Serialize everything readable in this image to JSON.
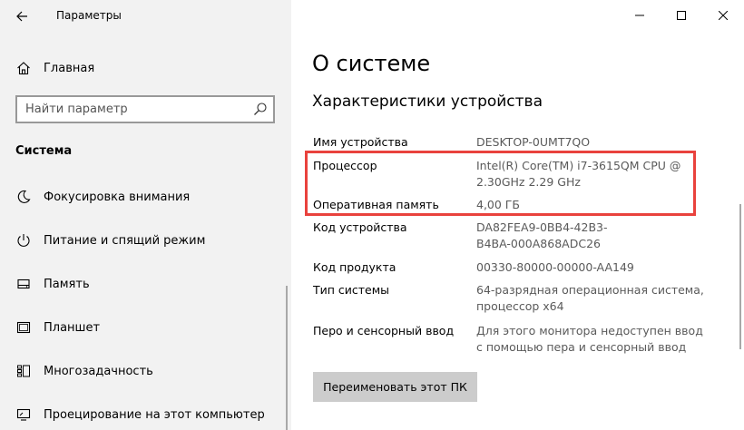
{
  "window": {
    "title": "Параметры"
  },
  "sidebar": {
    "home_label": "Главная",
    "search_placeholder": "Найти параметр",
    "section_header": "Система",
    "items": [
      {
        "label": "Фокусировка внимания",
        "icon": "moon-icon"
      },
      {
        "label": "Питание и спящий режим",
        "icon": "power-icon"
      },
      {
        "label": "Память",
        "icon": "storage-icon"
      },
      {
        "label": "Планшет",
        "icon": "tablet-icon"
      },
      {
        "label": "Многозадачность",
        "icon": "multitasking-icon"
      },
      {
        "label": "Проецирование на этот компьютер",
        "icon": "projecting-icon"
      }
    ]
  },
  "main": {
    "title": "О системе",
    "section_title": "Характеристики устройства",
    "specs": [
      {
        "label": "Имя устройства",
        "value": "DESKTOP-0UMT7QO"
      },
      {
        "label": "Процессор",
        "value": "Intel(R) Core(TM) i7-3615QM CPU @ 2.30GHz   2.29 GHz"
      },
      {
        "label": "Оперативная память",
        "value": "4,00 ГБ"
      },
      {
        "label": "Код устройства",
        "value": "DA82FEA9-0BB4-42B3-B4BA-000A868ADC26"
      },
      {
        "label": "Код продукта",
        "value": "00330-80000-00000-AA149"
      },
      {
        "label": "Тип системы",
        "value": "64-разрядная операционная система, процессор x64"
      },
      {
        "label": "Перо и сенсорный ввод",
        "value": "Для этого монитора недоступен ввод с помощью пера и сенсорный ввод"
      }
    ],
    "rename_button": "Переименовать этот ПК"
  },
  "colors": {
    "highlight": "#e9423d",
    "sidebar_bg": "#f2f2f2",
    "button_bg": "#cccccc"
  }
}
